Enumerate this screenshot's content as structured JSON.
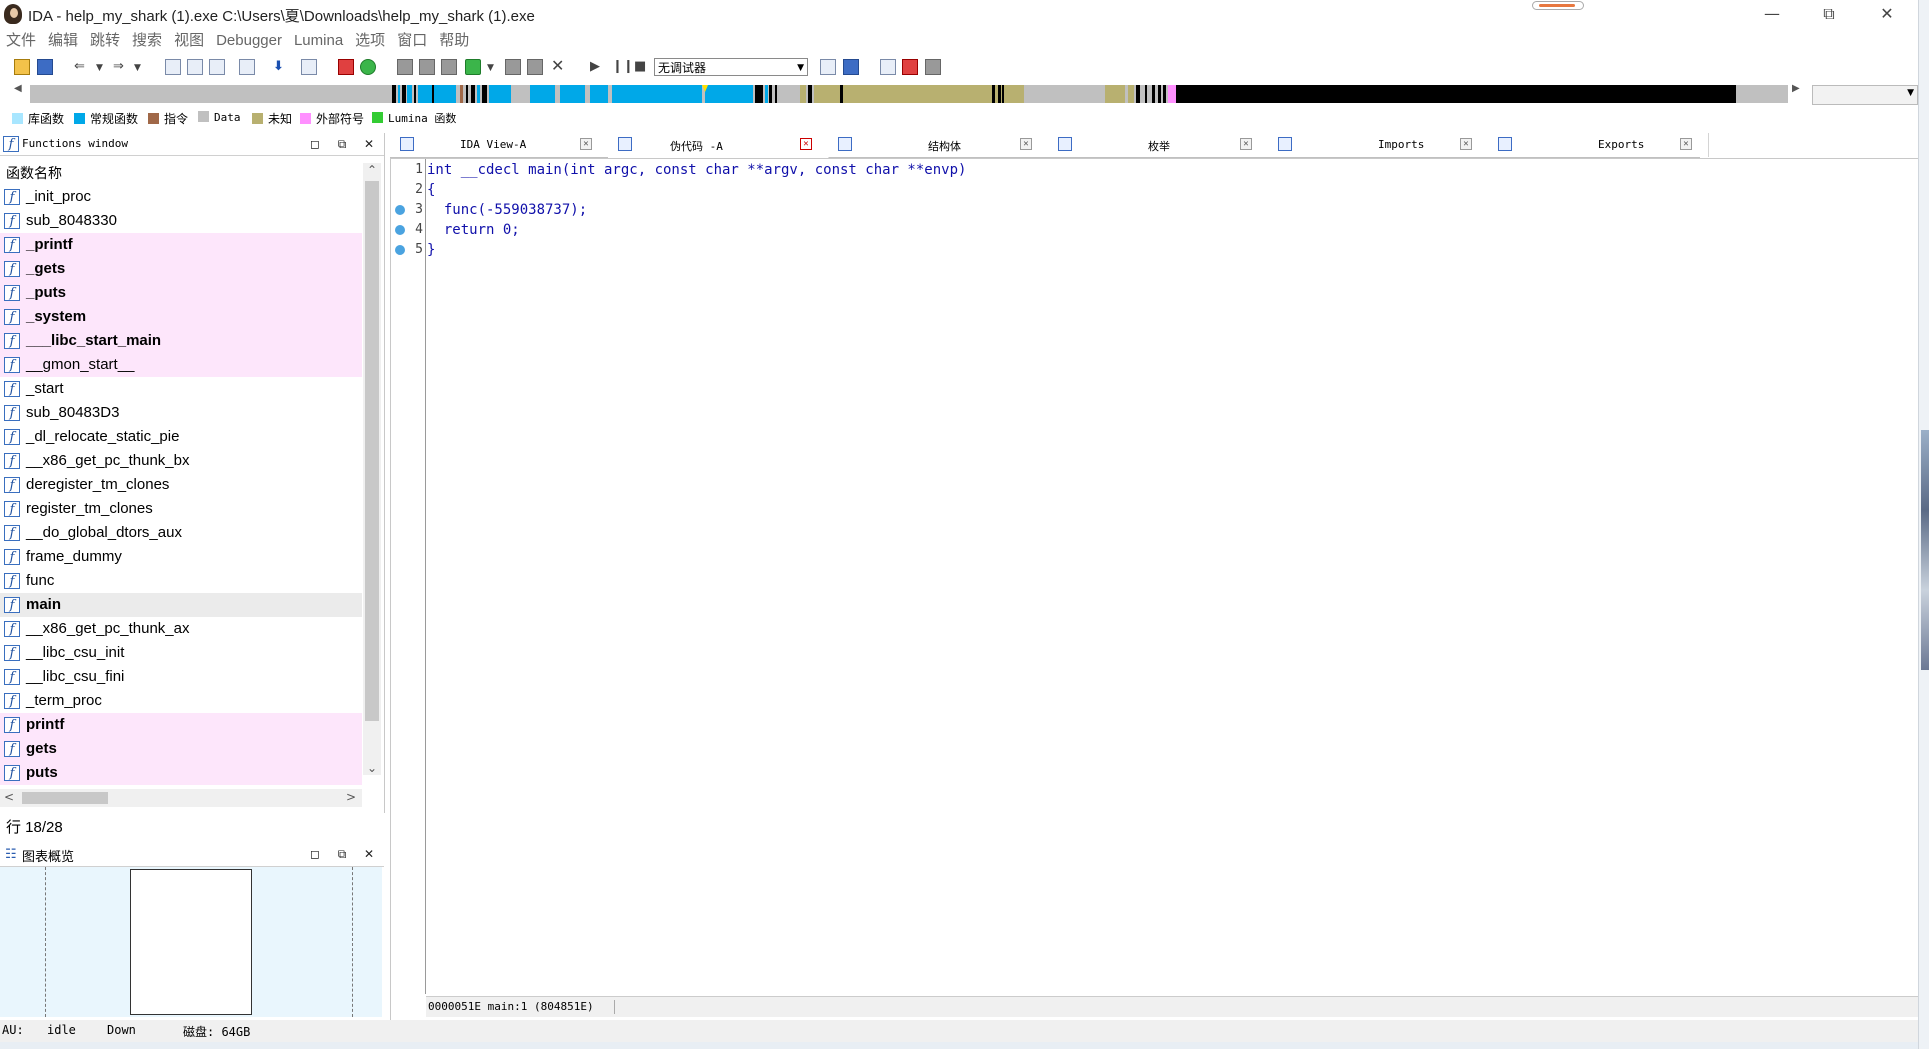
{
  "window": {
    "title": "IDA - help_my_shark (1).exe C:\\Users\\夏\\Downloads\\help_my_shark (1).exe",
    "minimize_icon": "minimize-icon",
    "maximize_icon": "restore-icon",
    "close_icon": "close-icon"
  },
  "menu": [
    "文件",
    "编辑",
    "跳转",
    "搜索",
    "视图",
    "Debugger",
    "Lumina",
    "选项",
    "窗口",
    "帮助"
  ],
  "toolbar": {
    "debugger_select": "无调试器"
  },
  "legend": [
    {
      "label": "库函数",
      "color": "#a8e6ff"
    },
    {
      "label": "常规函数",
      "color": "#00a8e8"
    },
    {
      "label": "指令",
      "color": "#a06848"
    },
    {
      "label": "Data",
      "color": "#c0c0c0"
    },
    {
      "label": "未知",
      "color": "#b8b070"
    },
    {
      "label": "外部符号",
      "color": "#ff90ff"
    },
    {
      "label": "Lumina 函数",
      "color": "#33cc33"
    }
  ],
  "functions_window": {
    "title": "Functions window",
    "column_header": "函数名称",
    "functions": [
      {
        "name": "_init_proc",
        "lib": false,
        "bold": false
      },
      {
        "name": "sub_8048330",
        "lib": false,
        "bold": false
      },
      {
        "name": "_printf",
        "lib": true,
        "bold": true
      },
      {
        "name": "_gets",
        "lib": true,
        "bold": true
      },
      {
        "name": "_puts",
        "lib": true,
        "bold": true
      },
      {
        "name": "_system",
        "lib": true,
        "bold": true
      },
      {
        "name": "___libc_start_main",
        "lib": true,
        "bold": true
      },
      {
        "name": "__gmon_start__",
        "lib": true,
        "bold": false
      },
      {
        "name": "_start",
        "lib": false,
        "bold": false
      },
      {
        "name": "sub_80483D3",
        "lib": false,
        "bold": false
      },
      {
        "name": "_dl_relocate_static_pie",
        "lib": false,
        "bold": false
      },
      {
        "name": "__x86_get_pc_thunk_bx",
        "lib": false,
        "bold": false
      },
      {
        "name": "deregister_tm_clones",
        "lib": false,
        "bold": false
      },
      {
        "name": "register_tm_clones",
        "lib": false,
        "bold": false
      },
      {
        "name": "__do_global_dtors_aux",
        "lib": false,
        "bold": false
      },
      {
        "name": "frame_dummy",
        "lib": false,
        "bold": false
      },
      {
        "name": "func",
        "lib": false,
        "bold": false
      },
      {
        "name": "main",
        "lib": false,
        "bold": true,
        "selected": true
      },
      {
        "name": "__x86_get_pc_thunk_ax",
        "lib": false,
        "bold": false
      },
      {
        "name": "__libc_csu_init",
        "lib": false,
        "bold": false
      },
      {
        "name": "__libc_csu_fini",
        "lib": false,
        "bold": false
      },
      {
        "name": "_term_proc",
        "lib": false,
        "bold": false
      },
      {
        "name": "printf",
        "lib": true,
        "bold": true
      },
      {
        "name": "gets",
        "lib": true,
        "bold": true
      },
      {
        "name": "puts",
        "lib": true,
        "bold": true
      }
    ],
    "row_status": "行 18/28"
  },
  "graph_overview": {
    "title": "图表概览"
  },
  "tabs": [
    {
      "label": "IDA View-A",
      "icon": "ida-view-icon",
      "active": false
    },
    {
      "label": "伪代码 -A",
      "icon": "pseudocode-icon",
      "active": true
    },
    {
      "label": "结构体",
      "icon": "structures-icon",
      "active": false
    },
    {
      "label": "枚举",
      "icon": "enums-icon",
      "active": false
    },
    {
      "label": "Imports",
      "icon": "imports-icon",
      "active": false
    },
    {
      "label": "Exports",
      "icon": "exports-icon",
      "active": false
    }
  ],
  "code": {
    "lines": [
      {
        "num": "1",
        "text": "int __cdecl main(int argc, const char **argv, const char **envp)",
        "bp": false
      },
      {
        "num": "2",
        "text": "{",
        "bp": false
      },
      {
        "num": "3",
        "text": "  func(-559038737);",
        "bp": true
      },
      {
        "num": "4",
        "text": "  return 0;",
        "bp": true
      },
      {
        "num": "5",
        "text": "}",
        "bp": true
      }
    ],
    "status": "0000051E main:1 (804851E)"
  },
  "statusbar": {
    "au": "AU:",
    "state": "idle",
    "direction": "Down",
    "disk": "磁盘: 64GB"
  }
}
